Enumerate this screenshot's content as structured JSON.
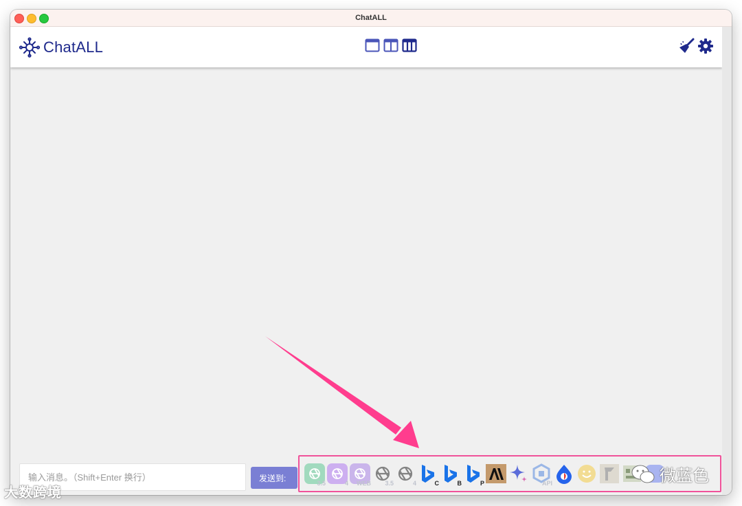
{
  "window": {
    "title": "ChatALL"
  },
  "app": {
    "logo_text": "ChatALL"
  },
  "header": {
    "layouts": [
      "single-column",
      "two-columns",
      "three-columns"
    ],
    "active_layout": "three-columns",
    "actions": [
      "clear-history-icon",
      "settings-gear-icon"
    ]
  },
  "footer": {
    "input_placeholder": "输入消息。（Shift+Enter 换行）",
    "input_value": "",
    "send_label": "发送到:"
  },
  "bots": [
    {
      "icon": "chatgpt-icon",
      "badge": "3.5",
      "color": "#7fd0a8"
    },
    {
      "icon": "chatgpt-icon",
      "badge": "4",
      "color": "#c29af0"
    },
    {
      "icon": "chatgpt-icon",
      "badge": "WEB",
      "color": "#b99be8"
    },
    {
      "icon": "openai-icon",
      "badge": "3.5",
      "color": "#555555"
    },
    {
      "icon": "openai-icon",
      "badge": "4",
      "color": "#555555"
    },
    {
      "icon": "bing-icon",
      "badge": "C",
      "color": "#1a73e8"
    },
    {
      "icon": "bing-icon",
      "badge": "B",
      "color": "#1a73e8"
    },
    {
      "icon": "bing-icon",
      "badge": "P",
      "color": "#1a73e8"
    },
    {
      "icon": "anthropic-icon",
      "badge": "",
      "color": "#c49a6c"
    },
    {
      "icon": "bard-icon",
      "badge": "",
      "color": "#5b6cd9"
    },
    {
      "icon": "llama-icon",
      "badge": "API",
      "color": "#9bb7e6"
    },
    {
      "icon": "ernie-icon",
      "badge": "",
      "color": "#2563eb"
    },
    {
      "icon": "smiley-icon",
      "badge": "",
      "color": "#f2d36b"
    },
    {
      "icon": "chatglm-icon",
      "badge": "",
      "color": "#b0b0b0"
    },
    {
      "icon": "moss-icon",
      "badge": "",
      "color": "#8a9b7a"
    },
    {
      "icon": "spark-icon",
      "badge": "",
      "color": "#7a8cf0"
    }
  ],
  "watermarks": {
    "left": "大数跨境",
    "right": "微蓝色"
  },
  "colors": {
    "accent": "#1f2a8c",
    "send": "#7a7fd4",
    "highlight": "#f0529a"
  }
}
